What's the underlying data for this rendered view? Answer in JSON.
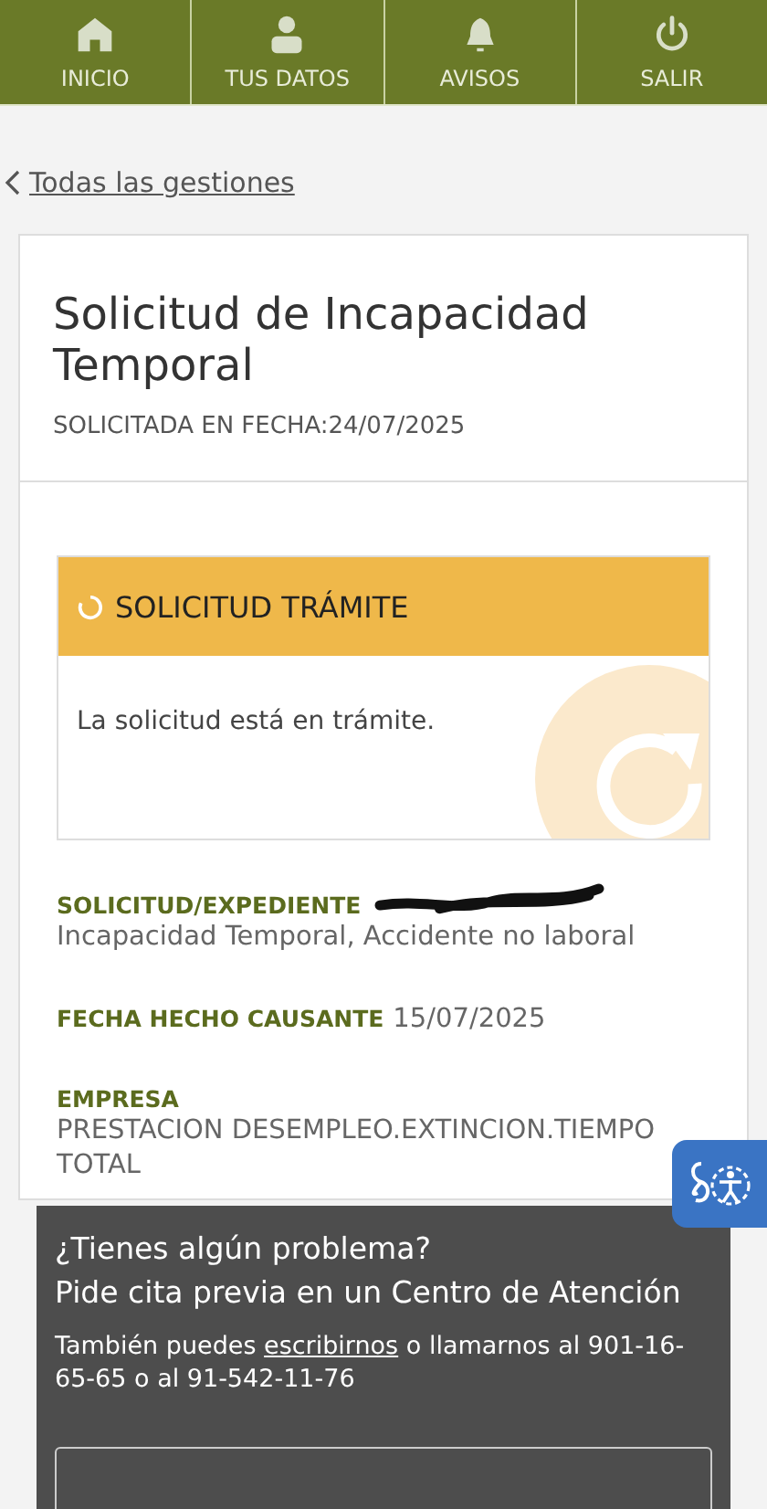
{
  "nav": [
    {
      "kind": "home",
      "label": "INICIO"
    },
    {
      "kind": "user",
      "label": "TUS DATOS"
    },
    {
      "kind": "bell",
      "label": "AVISOS"
    },
    {
      "kind": "power",
      "label": "SALIR"
    }
  ],
  "back_link": "Todas las gestiones",
  "request": {
    "title": "Solicitud de Incapacidad Temporal",
    "date_line": "SOLICITADA EN FECHA:24/07/2025",
    "status": {
      "kind": "in_progress",
      "title": "SOLICITUD TRÁMITE",
      "message": "La solicitud está en trámite."
    },
    "details": [
      {
        "label": "SOLICITUD/EXPEDIENTE",
        "redacted": true,
        "value": "Incapacidad Temporal, Accidente no laboral"
      },
      {
        "label": "FECHA HECHO CAUSANTE",
        "redacted": false,
        "value": "15/07/2025"
      },
      {
        "label": "EMPRESA",
        "redacted": false,
        "value": "PRESTACION DESEMPLEO.EXTINCION.TIEMPO TOTAL"
      }
    ]
  },
  "help": {
    "title": "¿Tienes algún problema?",
    "subtitle": "Pide cita previa en un Centro de Atención",
    "text_before": "También puedes",
    "link": "escribirnos",
    "text_after": "o llamarnos al 901-16-65-65 o al 91-542-11-76"
  }
}
